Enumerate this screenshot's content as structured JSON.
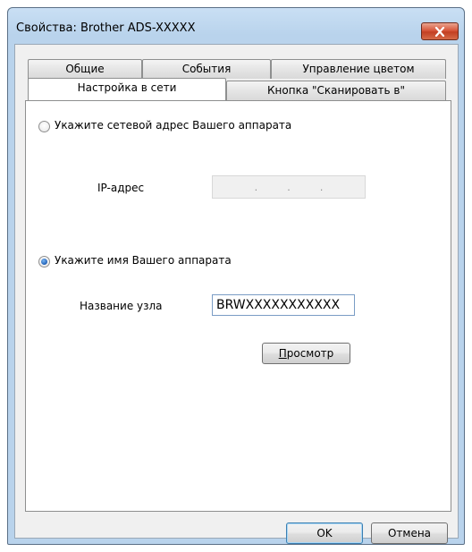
{
  "window": {
    "title": "Свойства: Brother ADS-XXXXX"
  },
  "tabs": {
    "row1": [
      "Общие",
      "События",
      "Управление цветом"
    ],
    "row2": [
      "Настройка в сети",
      "Кнопка \"Сканировать в\""
    ],
    "active": "Настройка в сети"
  },
  "address_option": {
    "label": "Укажите сетевой адрес Вашего аппарата",
    "selected": false,
    "ip_label": "IP-адрес",
    "ip_separators": [
      ".",
      ".",
      "."
    ]
  },
  "name_option": {
    "label": "Укажите имя  Вашего аппарата",
    "selected": true,
    "node_label": "Название узла",
    "node_value": "BRWXXXXXXXXXXX"
  },
  "browse_button": {
    "accel": "П",
    "rest": "росмотр"
  },
  "footer": {
    "ok_label": "OK",
    "cancel_label": "Отмена"
  },
  "colors": {
    "title_bar": "#b9d3ec",
    "close": "#c33f22",
    "radio_selected": "#1f5fb6"
  }
}
